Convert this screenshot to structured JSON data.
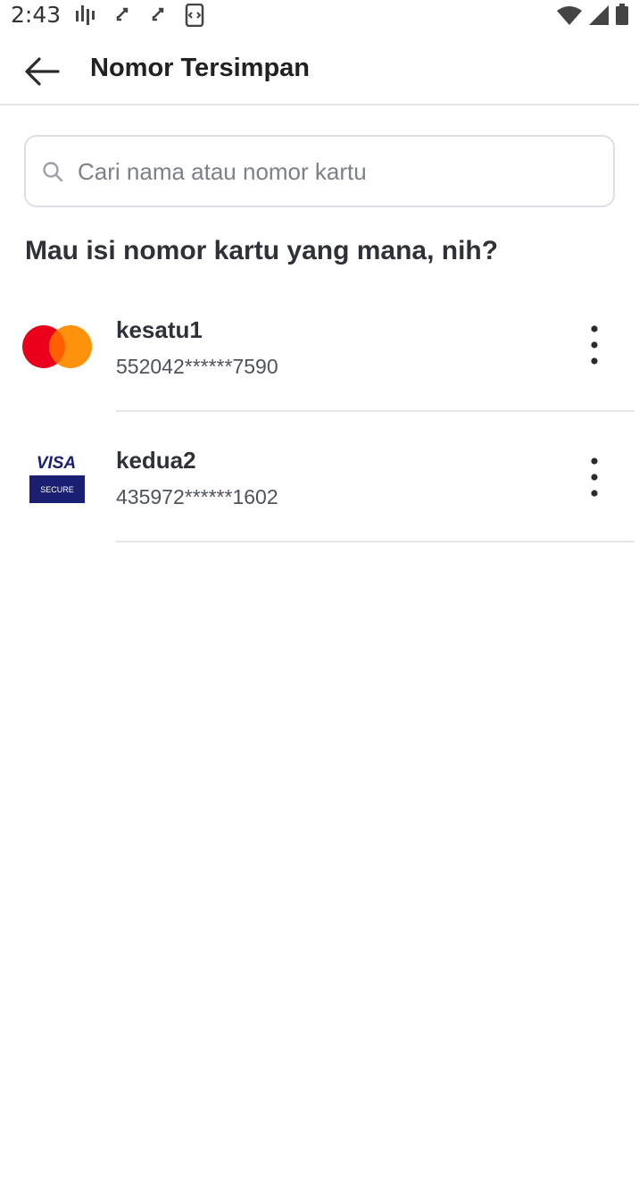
{
  "status_bar": {
    "time": "2:43"
  },
  "header": {
    "title": "Nomor Tersimpan",
    "back_icon": "arrow-left-icon"
  },
  "search": {
    "placeholder": "Cari nama atau nomor kartu",
    "value": "",
    "icon": "search-icon"
  },
  "question": "Mau isi nomor kartu yang mana, nih?",
  "cards": [
    {
      "name": "kesatu1",
      "number": "552042******7590",
      "brand": "mastercard",
      "brand_colors": [
        "#eb001b",
        "#ff8c00"
      ]
    },
    {
      "name": "kedua2",
      "number": "435972******1602",
      "brand": "visa-secure",
      "logo_text_top": "VISA",
      "logo_text_bottom": "SECURE",
      "brand_colors": [
        "#1a1f71",
        "#ffffff"
      ]
    }
  ],
  "colors": {
    "text_primary": "#2e3137",
    "divider": "#e4e6ea",
    "placeholder": "#7b8089"
  }
}
